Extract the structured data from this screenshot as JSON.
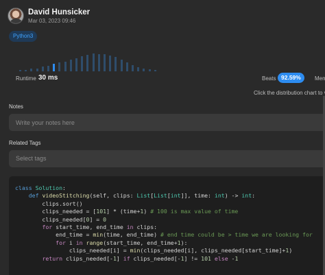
{
  "author": {
    "name": "David Hunsicker",
    "date": "Mar 03, 2023 09:46"
  },
  "language_badge": "Python3",
  "stats": {
    "runtime_label": "Runtime",
    "runtime_value": "30 ms",
    "beats_label": "Beats",
    "beats_value": "92.59%",
    "memory_label": "Mem",
    "distribution_hint": "Click the distribution chart to v"
  },
  "distribution": {
    "bars": [
      0.08,
      0.08,
      0.12,
      0.14,
      0.22,
      0.28,
      0.35,
      0.42,
      0.48,
      0.55,
      0.62,
      0.72,
      0.8,
      0.86,
      0.84,
      0.82,
      0.78,
      0.7,
      0.58,
      0.42,
      0.3,
      0.2,
      0.14,
      0.1,
      0.06
    ],
    "active_index": 6,
    "colors": {
      "bar": "#2f4d6b",
      "active": "#2d8cf0"
    }
  },
  "notes": {
    "label": "Notes",
    "placeholder": "Write your notes here"
  },
  "tags": {
    "label": "Related Tags",
    "placeholder": "Select tags"
  },
  "code": {
    "lines": [
      "class Solution:",
      "    def videoStitching(self, clips: List[List[int]], time: int) -> int:",
      "        clips.sort()",
      "        clips_needed = [101] * (time+1) # 100 is max value of time",
      "        clips_needed[0] = 0",
      "        for start_time, end_time in clips:",
      "            end_time = min(time, end_time) # end time could be > time we are looking for",
      "            for i in range(start_time, end_time+1):",
      "                clips_needed[i] = min(clips_needed[i], clips_needed[start_time]+1)",
      "        return clips_needed[-1] if clips_needed[-1] != 101 else -1"
    ]
  }
}
